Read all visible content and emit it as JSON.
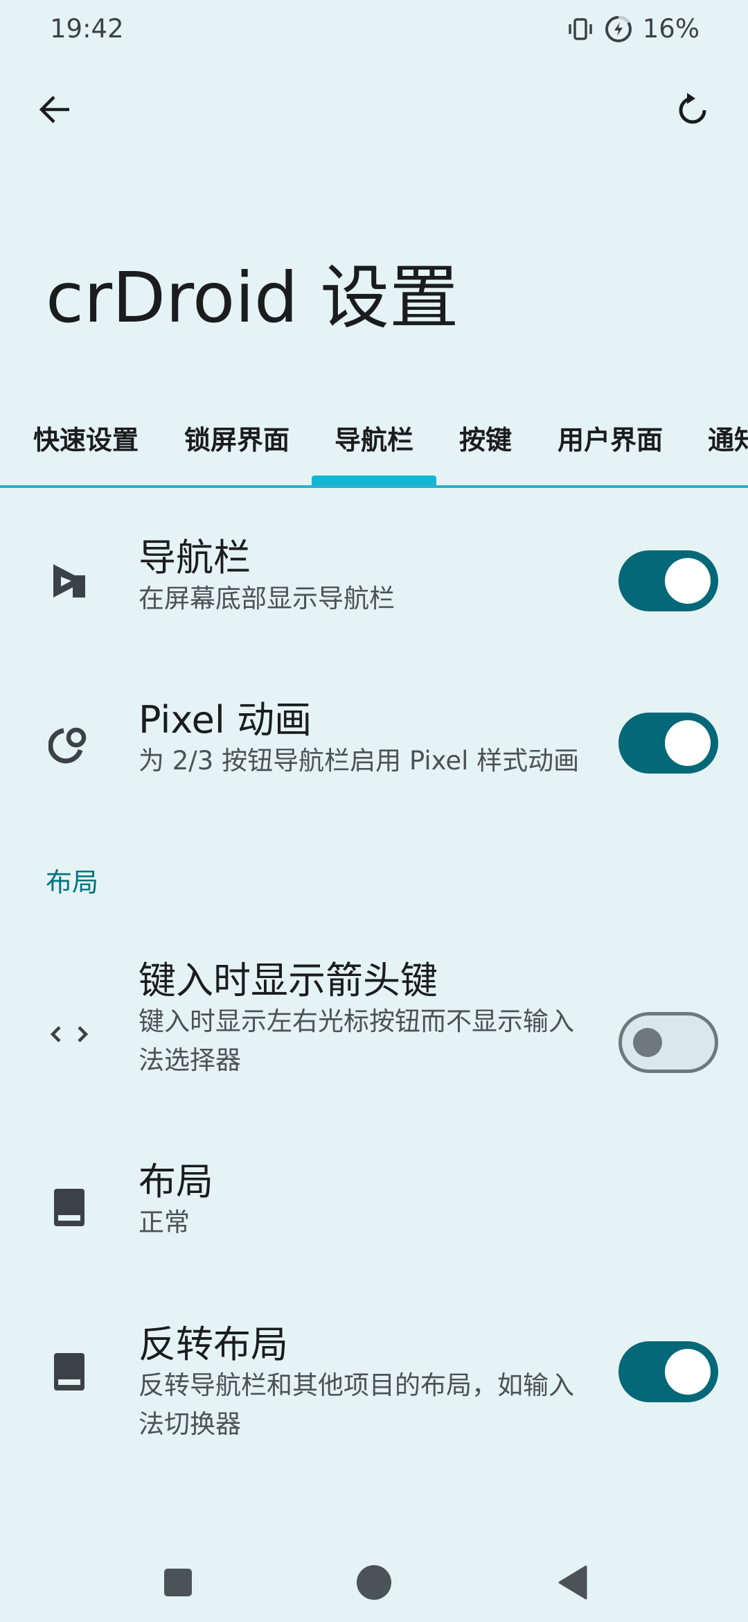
{
  "status": {
    "time": "19:42",
    "battery": "16%",
    "icons": [
      "vibrate-icon",
      "battery-saver-icon"
    ]
  },
  "toolbar": {
    "back_icon": "arrow-back-icon",
    "reset_icon": "reset-icon"
  },
  "page_title": "crDroid 设置",
  "tabs": [
    {
      "label": "快速设置"
    },
    {
      "label": "锁屏界面"
    },
    {
      "label": "导航栏"
    },
    {
      "label": "按键"
    },
    {
      "label": "用户界面"
    },
    {
      "label": "通知"
    }
  ],
  "selected_tab": "导航栏",
  "settings": [
    {
      "title": "导航栏",
      "subtitle": "在屏幕底部显示导航栏",
      "icon": "navigation-bar-icon",
      "switch": true
    },
    {
      "title": "Pixel 动画",
      "subtitle": "为 2/3 按钮导航栏启用 Pixel 样式动画",
      "icon": "animation-icon",
      "switch": true
    }
  ],
  "section_layout": "布局",
  "layout_settings": [
    {
      "title": "键入时显示箭头键",
      "subtitle": "键入时显示左右光标按钮而不显示输入法选择器",
      "icon": "code-arrows-icon",
      "switch": false
    },
    {
      "title": "布局",
      "subtitle": "正常",
      "icon": "phone-bottom-icon"
    },
    {
      "title": "反转布局",
      "subtitle": "反转导航栏和其他项目的布局，如输入法切换器",
      "icon": "phone-bottom-icon",
      "switch": true
    }
  ],
  "colors": {
    "background": "#e6f3f5",
    "accent": "#046878",
    "tab_indicator": "#12b6d4",
    "section_header": "#04727f"
  },
  "nav": {
    "recents_icon": "square-recents-icon",
    "home_icon": "circle-home-icon",
    "back_icon": "triangle-back-icon"
  }
}
